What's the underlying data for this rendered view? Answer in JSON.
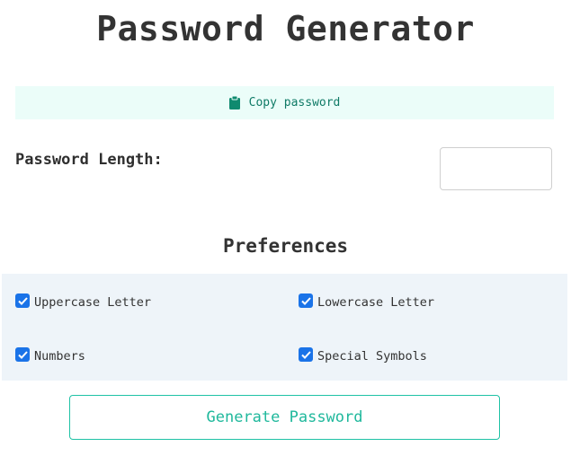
{
  "header": {
    "title": "Password Generator"
  },
  "copy": {
    "label": "Copy password",
    "icon": "clipboard-icon"
  },
  "length": {
    "label": "Password Length:",
    "value": "",
    "placeholder": ""
  },
  "preferences": {
    "title": "Preferences",
    "options": [
      {
        "label": "Uppercase Letter",
        "checked": true
      },
      {
        "label": "Lowercase Letter",
        "checked": true
      },
      {
        "label": "Numbers",
        "checked": true
      },
      {
        "label": "Special Symbols",
        "checked": true
      }
    ]
  },
  "actions": {
    "generate_label": "Generate Password"
  },
  "colors": {
    "accent": "#1fc2a5",
    "copy_bg": "#ebfdf9",
    "panel_bg": "#eef4f9",
    "checkbox": "#1a73e8"
  }
}
